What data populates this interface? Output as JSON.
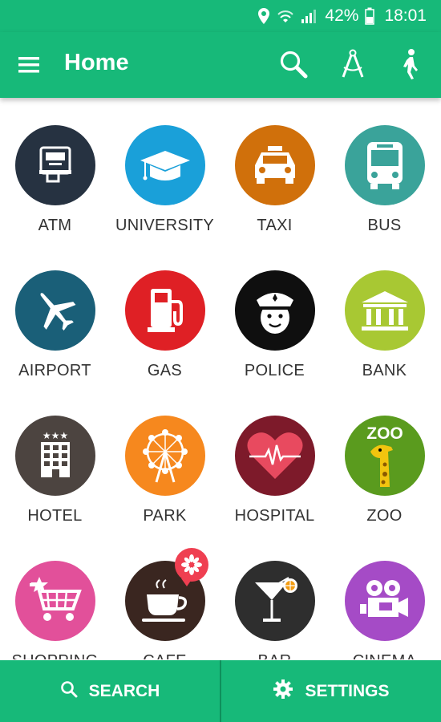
{
  "status_bar": {
    "battery": "42%",
    "time": "18:01"
  },
  "appbar": {
    "title": "Home"
  },
  "categories": [
    {
      "label": "ATM",
      "color": "#263241",
      "icon": "atm-icon"
    },
    {
      "label": "UNIVERSITY",
      "color": "#1aa0d9",
      "icon": "graduation-cap-icon"
    },
    {
      "label": "TAXI",
      "color": "#d0700b",
      "icon": "taxi-icon"
    },
    {
      "label": "BUS",
      "color": "#3aa39a",
      "icon": "bus-icon"
    },
    {
      "label": "AIRPORT",
      "color": "#1a5f78",
      "icon": "airplane-icon"
    },
    {
      "label": "GAS",
      "color": "#df2025",
      "icon": "gas-pump-icon"
    },
    {
      "label": "POLICE",
      "color": "#0f0f0f",
      "icon": "police-officer-icon"
    },
    {
      "label": "BANK",
      "color": "#a8c833",
      "icon": "bank-icon"
    },
    {
      "label": "HOTEL",
      "color": "#4c4440",
      "icon": "hotel-icon"
    },
    {
      "label": "PARK",
      "color": "#f6881e",
      "icon": "ferris-wheel-icon"
    },
    {
      "label": "HOSPITAL",
      "color": "#7d1a2a",
      "icon": "heartbeat-icon"
    },
    {
      "label": "ZOO",
      "color": "#5a9b1e",
      "icon": "giraffe-icon"
    },
    {
      "label": "SHOPPING",
      "color": "#e2509a",
      "icon": "shopping-cart-icon"
    },
    {
      "label": "CAFE",
      "color": "#3a2620",
      "icon": "coffee-cup-icon"
    },
    {
      "label": "BAR",
      "color": "#2e2e2e",
      "icon": "cocktail-icon"
    },
    {
      "label": "CINEMA",
      "color": "#a54bc6",
      "icon": "movie-camera-icon"
    }
  ],
  "zoo_text": "ZOO",
  "bottom_bar": {
    "search_label": "SEARCH",
    "settings_label": "SETTINGS"
  },
  "colors": {
    "primary": "#17b979",
    "badge": "#ef3f51"
  }
}
